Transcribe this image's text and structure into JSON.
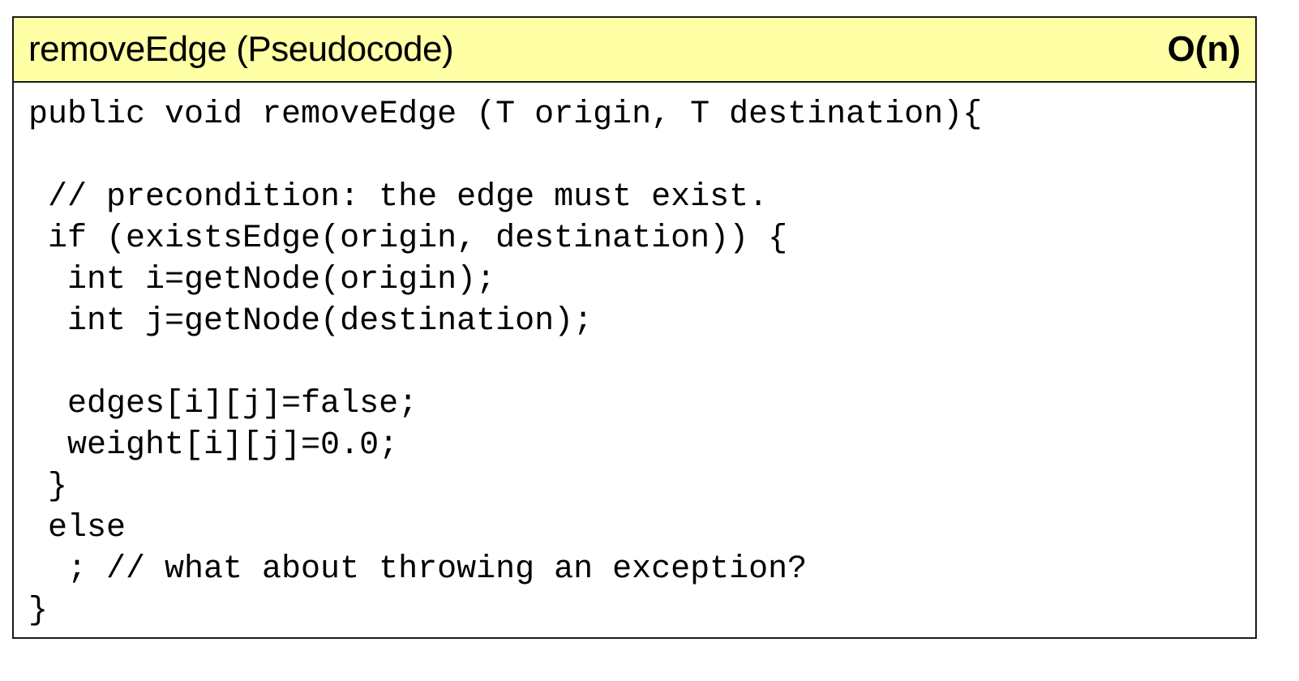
{
  "panel": {
    "title": "removeEdge (Pseudocode)",
    "complexity": "O(n)"
  },
  "code": {
    "lines": [
      "public void removeEdge (T origin, T destination){",
      "",
      " // precondition: the edge must exist.",
      " if (existsEdge(origin, destination)) {",
      "  int i=getNode(origin);",
      "  int j=getNode(destination);",
      "",
      "  edges[i][j]=false;",
      "  weight[i][j]=0.0;",
      " }",
      " else",
      "  ; // what about throwing an exception?",
      "}"
    ]
  },
  "colors": {
    "header_background": "#ffffa6",
    "border": "#1a1a1a"
  }
}
